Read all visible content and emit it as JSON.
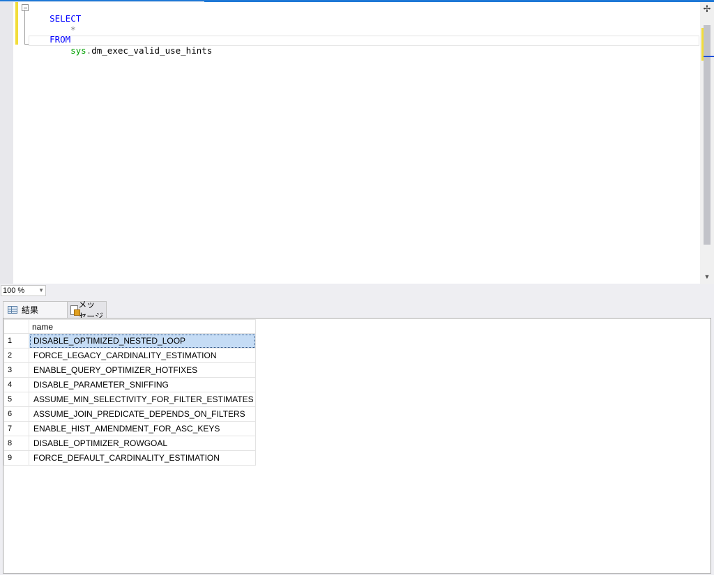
{
  "editor": {
    "lines": {
      "select_kw": "SELECT",
      "star": "*",
      "from_kw": "FROM",
      "schema": "sys",
      "dot": ".",
      "object": "dm_exec_valid_use_hints"
    }
  },
  "zoom": {
    "value": "100 %"
  },
  "tabs": {
    "results_label": "結果",
    "messages_label": "メッセージ"
  },
  "grid": {
    "column": "name",
    "rows": [
      {
        "no": "1",
        "name": "DISABLE_OPTIMIZED_NESTED_LOOP"
      },
      {
        "no": "2",
        "name": "FORCE_LEGACY_CARDINALITY_ESTIMATION"
      },
      {
        "no": "3",
        "name": "ENABLE_QUERY_OPTIMIZER_HOTFIXES"
      },
      {
        "no": "4",
        "name": "DISABLE_PARAMETER_SNIFFING"
      },
      {
        "no": "5",
        "name": "ASSUME_MIN_SELECTIVITY_FOR_FILTER_ESTIMATES"
      },
      {
        "no": "6",
        "name": "ASSUME_JOIN_PREDICATE_DEPENDS_ON_FILTERS"
      },
      {
        "no": "7",
        "name": "ENABLE_HIST_AMENDMENT_FOR_ASC_KEYS"
      },
      {
        "no": "8",
        "name": "DISABLE_OPTIMIZER_ROWGOAL"
      },
      {
        "no": "9",
        "name": "FORCE_DEFAULT_CARDINALITY_ESTIMATION"
      }
    ]
  },
  "colors": {
    "keyword": "#0000ff",
    "schema": "#00a000",
    "selection": "#c5dcf5",
    "accent": "#1e78d6"
  }
}
